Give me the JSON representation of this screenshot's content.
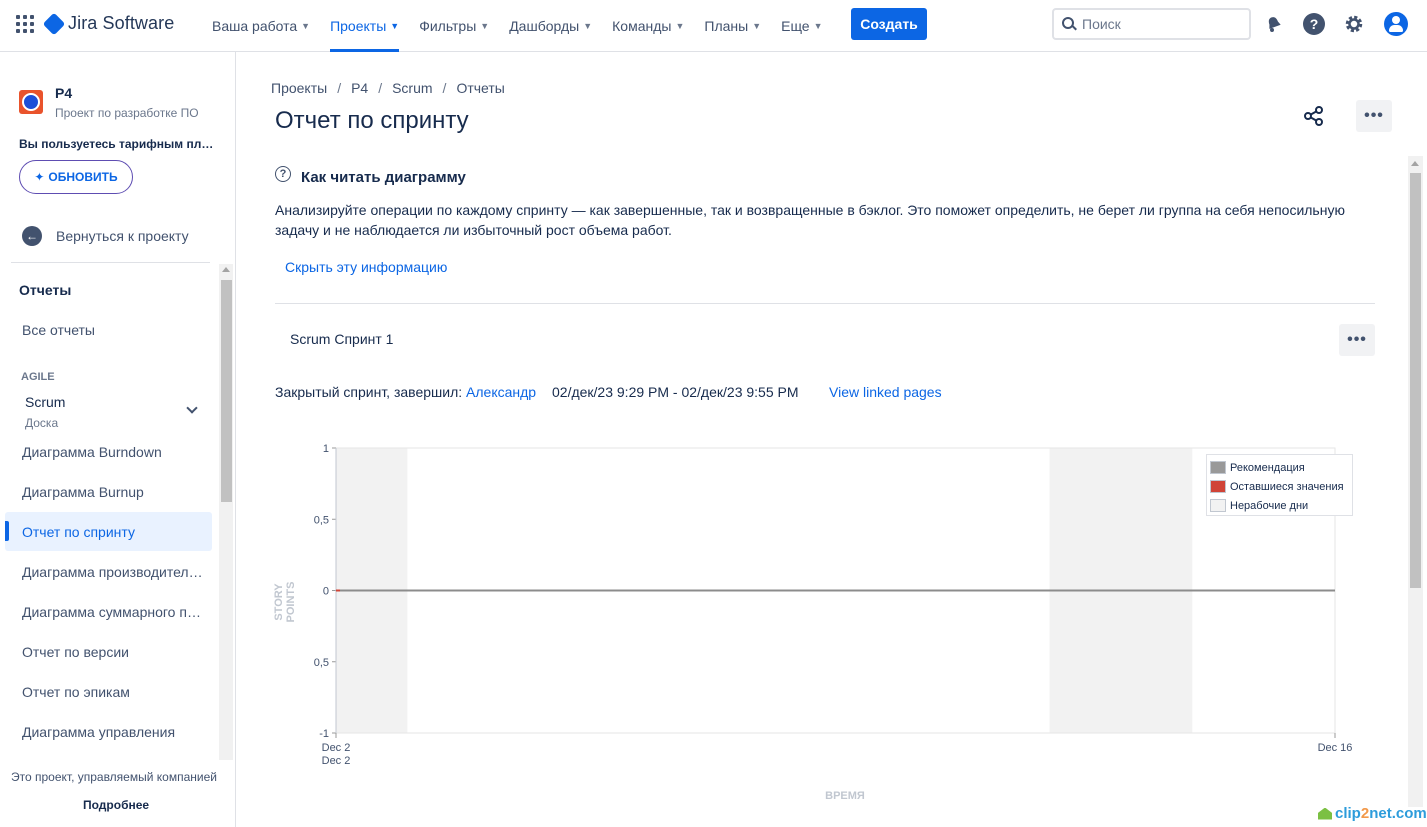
{
  "topbar": {
    "app_name": "Jira Software",
    "nav": [
      {
        "label": "Ваша работа",
        "active": false
      },
      {
        "label": "Проекты",
        "active": true
      },
      {
        "label": "Фильтры",
        "active": false
      },
      {
        "label": "Дашборды",
        "active": false
      },
      {
        "label": "Команды",
        "active": false
      },
      {
        "label": "Планы",
        "active": false
      },
      {
        "label": "Еще",
        "active": false
      }
    ],
    "create_label": "Создать",
    "search_placeholder": "Поиск",
    "help_glyph": "?"
  },
  "sidebar": {
    "project_name": "P4",
    "project_type": "Проект по разработке ПО",
    "plan_text": "Вы пользуетесь тарифным планом Free",
    "upgrade_label": "ОБНОВИТЬ",
    "back_label": "Вернуться к проекту",
    "section_title": "Отчеты",
    "all_reports": "Все отчеты",
    "agile_label": "AGILE",
    "board_name": "Scrum",
    "board_type": "Доска",
    "items": [
      {
        "label": "Диаграмма Burndown",
        "active": false
      },
      {
        "label": "Диаграмма Burnup",
        "active": false
      },
      {
        "label": "Отчет по спринту",
        "active": true
      },
      {
        "label": "Диаграмма производительности",
        "active": false
      },
      {
        "label": "Диаграмма суммарного потока",
        "active": false
      },
      {
        "label": "Отчет по версии",
        "active": false
      },
      {
        "label": "Отчет по эпикам",
        "active": false
      },
      {
        "label": "Диаграмма управления",
        "active": false
      }
    ],
    "footer_text": "Это проект, управляемый компанией",
    "footer_link": "Подробнее"
  },
  "breadcrumb": [
    "Проекты",
    "P4",
    "Scrum",
    "Отчеты"
  ],
  "page_title": "Отчет по спринту",
  "info": {
    "title": "Как читать диаграмму",
    "description": "Анализируйте операции по каждому спринту — как завершенные, так и возвращенные в бэклог. Это поможет определить, не берет ли группа на себя непосильную задачу и не наблюдается ли избыточный рост объема работ.",
    "hide_link": "Скрыть эту информацию"
  },
  "sprint": {
    "name": "Scrum Спринт 1",
    "closed_by_prefix": "Закрытый спринт, завершил:",
    "closed_by": "Александр",
    "dates": "02/дек/23 9:29 PM - 02/дек/23 9:55 PM",
    "linked_pages": "View linked pages"
  },
  "chart_data": {
    "type": "line",
    "ylabel": "STORY POINTS",
    "xlabel": "ВРЕМЯ",
    "ylim": [
      -1,
      1
    ],
    "y_ticks": [
      "1",
      "0,5",
      "0",
      "0,5",
      "-1"
    ],
    "x_ticks": [
      {
        "label": "Dec 2",
        "sublabel": "Dec 2",
        "day": 2
      },
      {
        "label": "Dec 16",
        "sublabel": "",
        "day": 16
      }
    ],
    "xlim_days": [
      2,
      16
    ],
    "non_working_days": [
      [
        2,
        3
      ],
      [
        12,
        14
      ]
    ],
    "series": [
      {
        "name": "Рекомендация",
        "color": "#999999",
        "points": [
          [
            2,
            0
          ],
          [
            16,
            0
          ]
        ]
      },
      {
        "name": "Оставшиеся значения",
        "color": "#d04437",
        "points": [
          [
            2,
            0
          ]
        ]
      },
      {
        "name": "Нерабочие дни",
        "color": "#f2f2f2",
        "points": []
      }
    ],
    "grid": false,
    "legend": "top-right"
  },
  "colors": {
    "accent": "#0c66e4",
    "text": "#172b4d",
    "muted": "#42526e"
  }
}
